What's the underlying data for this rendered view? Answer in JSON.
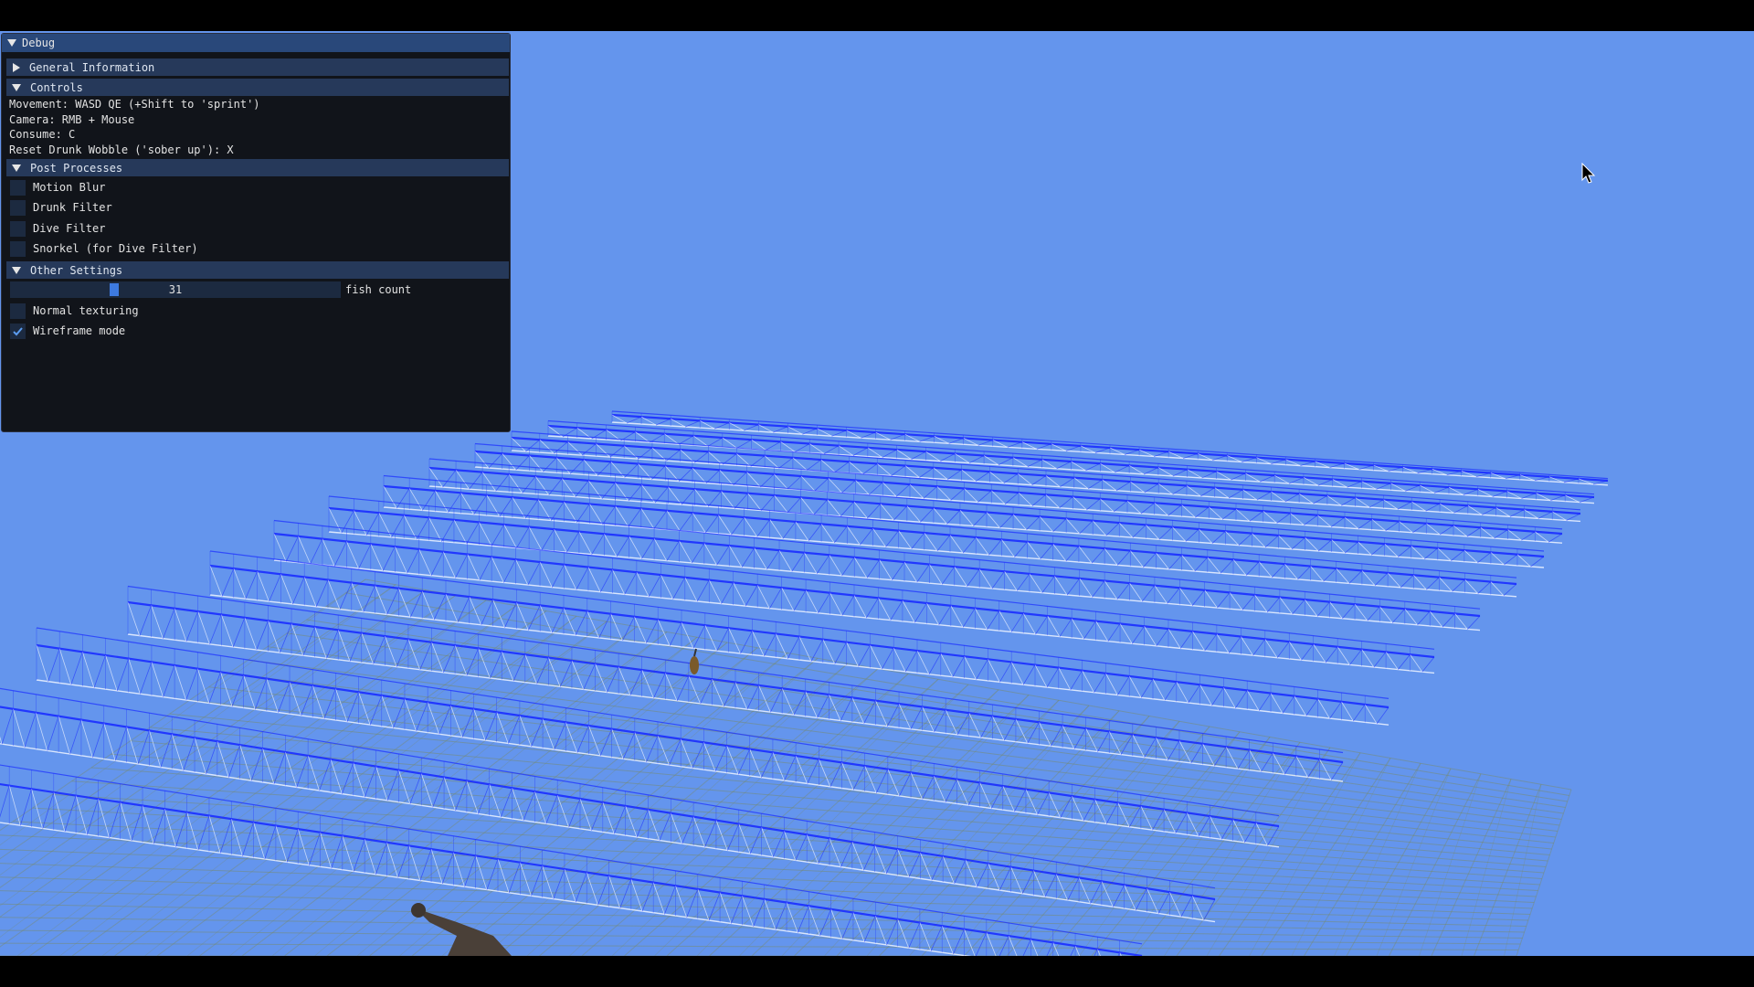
{
  "colors": {
    "sky": "#6495ed",
    "panel_bg": "#11141a",
    "title_bar": "#29487a",
    "header_bg": "#26395a",
    "checkbox_bg": "#1c2a40",
    "accent": "#3d7ae0",
    "wireframe_blue": "#1a2cff",
    "wireframe_white": "#eef4ff",
    "floor_mesh": "#7a8a5a"
  },
  "debug": {
    "title": "Debug",
    "sections": {
      "general": {
        "label": "General Information",
        "expanded": false
      },
      "controls": {
        "label": "Controls",
        "expanded": true,
        "lines": [
          "Movement: WASD QE (+Shift to 'sprint')",
          "Camera: RMB + Mouse",
          "Consume: C",
          "Reset Drunk Wobble ('sober up'): X"
        ]
      },
      "post": {
        "label": "Post Processes",
        "expanded": true,
        "options": [
          {
            "label": "Motion Blur",
            "checked": false
          },
          {
            "label": "Drunk Filter",
            "checked": false
          },
          {
            "label": "Dive Filter",
            "checked": false
          },
          {
            "label": "Snorkel (for Dive Filter)",
            "checked": false
          }
        ]
      },
      "other": {
        "label": "Other Settings",
        "expanded": true,
        "slider": {
          "value": "31",
          "label": "fish count",
          "fraction": 0.31
        },
        "options": [
          {
            "label": "Normal texturing",
            "checked": false
          },
          {
            "label": "Wireframe mode",
            "checked": true
          }
        ]
      }
    }
  },
  "scene": {
    "icons": [
      "mouse-cursor-icon"
    ]
  }
}
